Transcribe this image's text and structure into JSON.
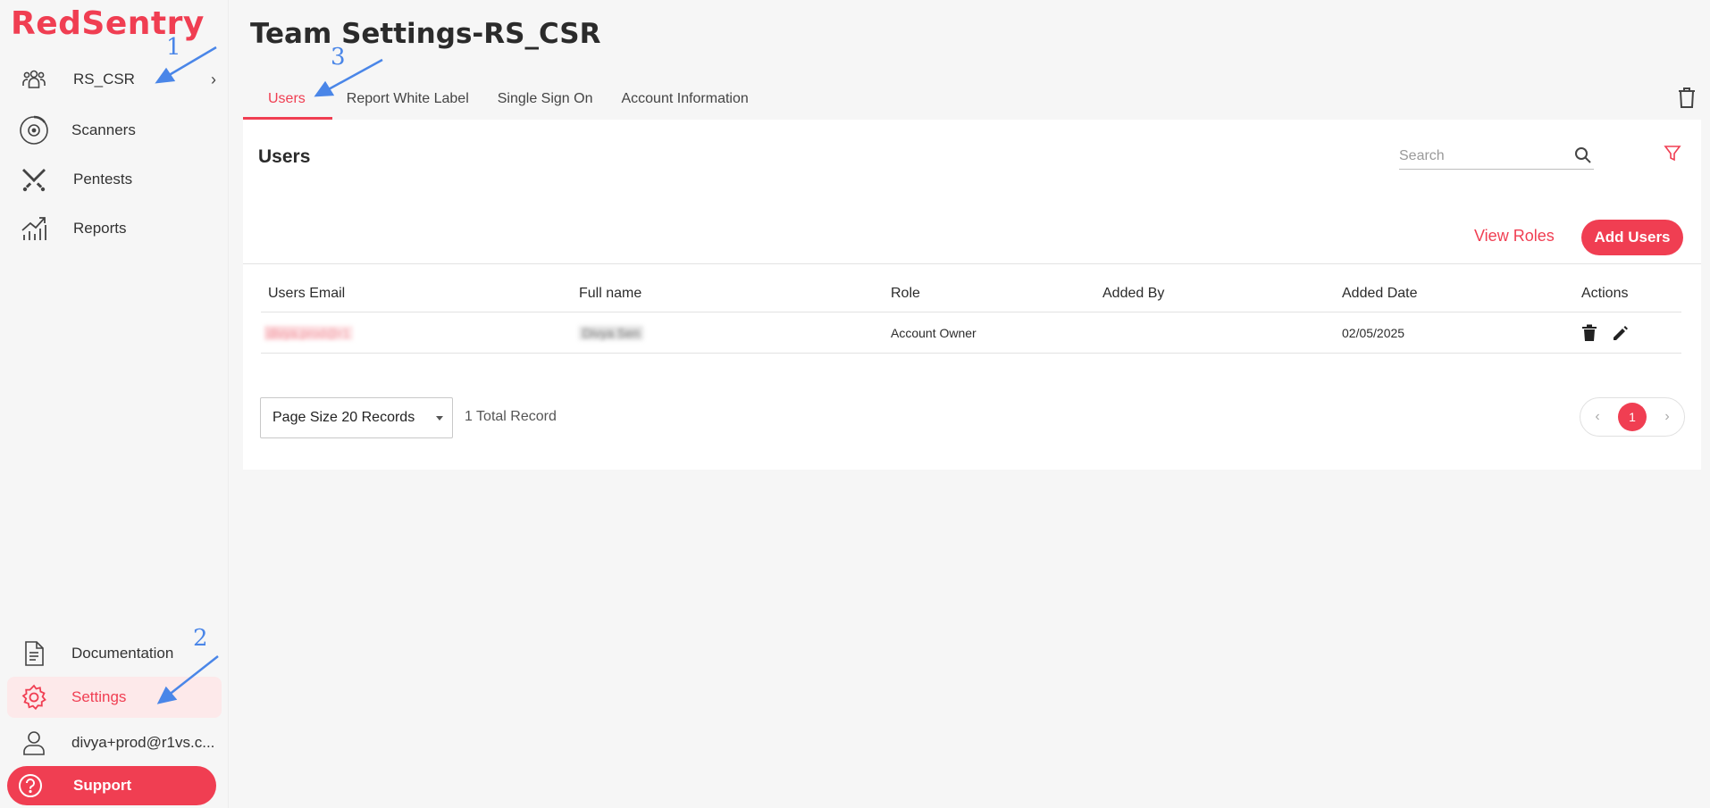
{
  "app": {
    "logo_text": "RedSentry",
    "accent_color": "#f03e52"
  },
  "sidebar": {
    "team": {
      "label": "RS_CSR",
      "icon": "team-icon",
      "chevron": "›"
    },
    "items": [
      {
        "label": "Scanners",
        "icon": "radar-icon"
      },
      {
        "label": "Pentests",
        "icon": "crossed-swords-icon"
      },
      {
        "label": "Reports",
        "icon": "chart-trend-icon"
      }
    ],
    "bottom": [
      {
        "label": "Documentation",
        "icon": "document-icon"
      },
      {
        "label": "Settings",
        "icon": "gear-icon",
        "active": true
      },
      {
        "label": "divya+prod@r1vs.c...",
        "icon": "user-icon"
      }
    ],
    "support": {
      "label": "Support",
      "icon": "help-icon"
    }
  },
  "page": {
    "title": "Team Settings-RS_CSR"
  },
  "tabs": [
    {
      "label": "Users",
      "active": true
    },
    {
      "label": "Report White Label"
    },
    {
      "label": "Single Sign On"
    },
    {
      "label": "Account Information"
    }
  ],
  "users_panel": {
    "title": "Users",
    "search_placeholder": "Search",
    "view_roles_label": "View Roles",
    "add_users_label": "Add Users",
    "columns": [
      "Users Email",
      "Full name",
      "Role",
      "Added By",
      "Added Date",
      "Actions"
    ],
    "rows": [
      {
        "email": "divya.prod@r1",
        "full_name": "Divya Sen",
        "role": "Account Owner",
        "added_by": "",
        "added_date": "02/05/2025"
      }
    ],
    "page_size_label": "Page Size 20 Records",
    "total_records": "1 Total Record",
    "pagination": {
      "prev": "‹",
      "current_page": "1",
      "next": "›"
    }
  },
  "annotations": [
    {
      "label": "1"
    },
    {
      "label": "2"
    },
    {
      "label": "3"
    }
  ]
}
